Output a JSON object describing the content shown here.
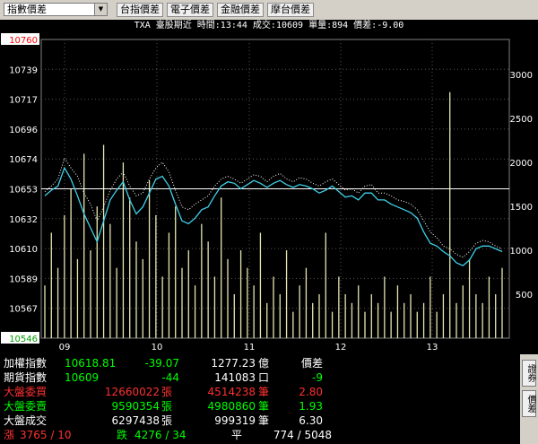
{
  "toolbar": {
    "select_value": "指數價差",
    "buttons": [
      "台指價差",
      "電子價差",
      "金融價差",
      "摩台價差"
    ]
  },
  "info_line": "TXA  臺股期近 時間:13:44 成交:10609 單量:894 價差:-9.00",
  "chart_data": {
    "type": "line",
    "title": "",
    "y_left_ticks": [
      "10760",
      "10739",
      "10717",
      "10696",
      "10674",
      "10653",
      "10632",
      "10610",
      "10589",
      "10567",
      "10546"
    ],
    "y_left_range": [
      10546,
      10760
    ],
    "y_right_ticks": [
      "3000",
      "2500",
      "2000",
      "1500",
      "1000",
      "500"
    ],
    "y_right_range": [
      0,
      3400
    ],
    "x_ticks": [
      "09",
      "10",
      "11",
      "12",
      "13"
    ],
    "reference_level": 10653,
    "series": [
      {
        "name": "",
        "color": "#ffffff",
        "style": "dotted",
        "values": [
          10651,
          10655,
          10660,
          10675,
          10668,
          10662,
          10650,
          10642,
          10630,
          10640,
          10652,
          10660,
          10665,
          10655,
          10648,
          10650,
          10660,
          10668,
          10672,
          10665,
          10652,
          10640,
          10638,
          10642,
          10645,
          10648,
          10655,
          10660,
          10662,
          10660,
          10657,
          10660,
          10663,
          10662,
          10658,
          10662,
          10664,
          10660,
          10658,
          10661,
          10660,
          10657,
          10655,
          10658,
          10660,
          10656,
          10652,
          10653,
          10650,
          10655,
          10656,
          10650,
          10650,
          10648,
          10645,
          10644,
          10642,
          10638,
          10630,
          10622,
          10618,
          10612,
          10610,
          10606,
          10604,
          10608,
          10614,
          10616,
          10615,
          10612,
          10610
        ]
      },
      {
        "name": "",
        "color": "#3fd0e8",
        "style": "solid",
        "values": [
          10648,
          10652,
          10655,
          10668,
          10660,
          10648,
          10635,
          10625,
          10615,
          10630,
          10645,
          10652,
          10658,
          10645,
          10635,
          10640,
          10650,
          10660,
          10662,
          10655,
          10642,
          10630,
          10628,
          10632,
          10638,
          10640,
          10648,
          10655,
          10658,
          10657,
          10653,
          10656,
          10659,
          10657,
          10654,
          10657,
          10659,
          10656,
          10654,
          10656,
          10655,
          10653,
          10650,
          10652,
          10655,
          10651,
          10647,
          10648,
          10645,
          10650,
          10650,
          10645,
          10645,
          10642,
          10640,
          10638,
          10636,
          10632,
          10622,
          10614,
          10612,
          10608,
          10605,
          10600,
          10598,
          10602,
          10610,
          10612,
          10612,
          10610,
          10608
        ]
      }
    ],
    "volume_series": {
      "name": "",
      "values": [
        600,
        1200,
        800,
        1400,
        1700,
        900,
        2100,
        1000,
        1500,
        2200,
        1300,
        800,
        2000,
        1600,
        1100,
        900,
        1800,
        1400,
        700,
        1200,
        1500,
        800,
        1000,
        600,
        1300,
        1100,
        700,
        1600,
        900,
        500,
        1000,
        800,
        600,
        1200,
        400,
        700,
        500,
        1000,
        300,
        600,
        800,
        400,
        500,
        1200,
        300,
        700,
        500,
        400,
        600,
        300,
        500,
        400,
        700,
        300,
        600,
        400,
        500,
        300,
        400,
        700,
        300,
        500,
        2800,
        400,
        600,
        900,
        500,
        400,
        700,
        500,
        800
      ]
    }
  },
  "bottom": {
    "rows": [
      {
        "label": "加權指數",
        "v1": "10618.81",
        "v2": "-39.07",
        "v3": "1277.23",
        "u3": "億",
        "v4": "價差"
      },
      {
        "label": "期貨指數",
        "v1": "10609",
        "v2": "-44",
        "v3": "141083",
        "u3": "口",
        "v4": "-9"
      },
      {
        "label": "大盤委買",
        "v1": "12660022",
        "u1": "張",
        "v3": "4514238",
        "u3": "筆",
        "v4": "2.80"
      },
      {
        "label": "大盤委賣",
        "v1": "9590354",
        "u1": "張",
        "v3": "4980860",
        "u3": "筆",
        "v4": "1.93"
      },
      {
        "label": "大盤成交",
        "v1": "6297438",
        "u1": "張",
        "v3": "999319",
        "u3": "筆",
        "v4": "6.30"
      }
    ],
    "last_row": {
      "up_label": "漲",
      "up_val": "3765 / 10",
      "down_label": "跌",
      "down_val": "4276 / 34",
      "flat_label": "平",
      "flat_val": "774 / 5048"
    }
  },
  "side_tabs": [
    "證券",
    "價差"
  ]
}
